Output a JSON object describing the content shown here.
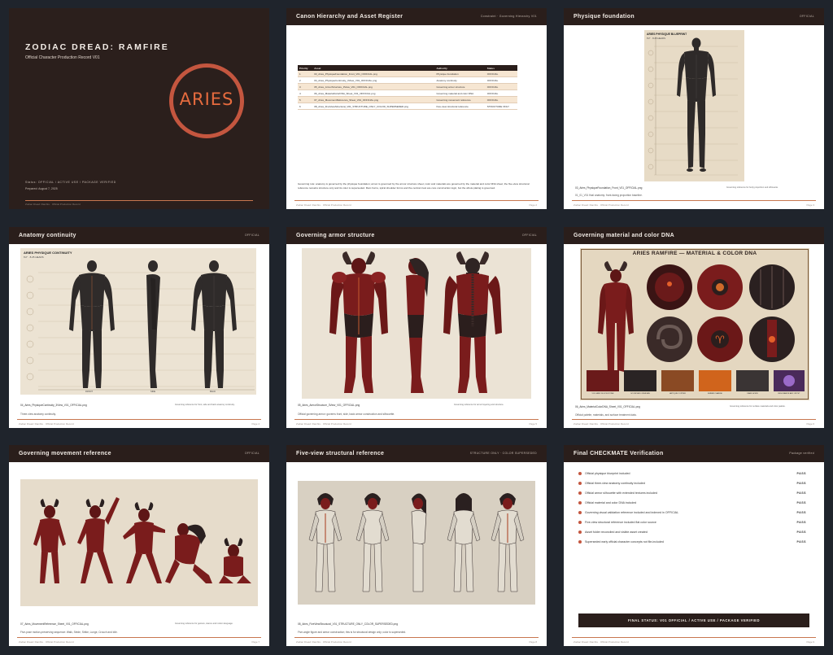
{
  "cover": {
    "title": "ZODIAC DREAD: RAMFIRE",
    "subtitle": "Official Character Production Record V01",
    "sign": "ARIES",
    "status": "Status: OFFICIAL / ACTIVE USE / PACKAGE VERIFIED",
    "prepared": "Prepared: August 7, 2025",
    "footer": "Zodiac Dread: Ramfire · Official Production Record"
  },
  "pages": [
    {
      "title": "Canon Hierarchy and Asset Register",
      "right": "Constraint · Governing Hierarchy V01",
      "footer_left": "Zodiac Dread: Ramfire · Official Production Record",
      "footer_right": "Page 2"
    },
    {
      "title": "Physique foundation",
      "right": "OFFICIAL",
      "caption1": "03_Aries_PhysiqueFoundation_Front_V01_OFFICIAL.png",
      "caption2": "Governing reference for body proportion and silhouette.",
      "caption3": "01_01_V01 final anatomy: front-facing proportion baseline.",
      "footer_left": "Zodiac Dread: Ramfire · Official Production Record",
      "footer_right": "Page 3"
    },
    {
      "title": "Anatomy continuity",
      "right": "OFFICIAL",
      "caption1": "04_Aries_PhysiqueContinuity_3View_V01_OFFICIAL.png",
      "caption2": "Governing reference for front, side and back anatomy continuity.",
      "caption3": "Three-view anatomy continuity.",
      "footer_left": "Zodiac Dread: Ramfire · Official Production Record",
      "footer_right": "Page 4"
    },
    {
      "title": "Governing armor structure",
      "right": "OFFICIAL",
      "caption1": "05_Aries_ArmorStructure_3View_V01_OFFICIAL.png",
      "caption2": "Governing reference for armor layering and structure.",
      "caption3": "Official governing armor: governs front, side, back armor construction and silhouette.",
      "footer_left": "Zodiac Dread: Ramfire · Official Production Record",
      "footer_right": "Page 5"
    },
    {
      "title": "Governing material and color DNA",
      "right": "",
      "caption1": "06_Aries_MaterialColorDNA_Sheet_V01_OFFICIAL.png",
      "caption2": "Governing reference for surface materials and color palette.",
      "caption3": "Official palette, materials, and surface treatment data.",
      "footer_left": "Zodiac Dread: Ramfire · Official Production Record",
      "footer_right": "Page 6"
    },
    {
      "title": "Governing movement reference",
      "right": "OFFICIAL",
      "caption1": "07_Aries_MovementReference_Sheet_V01_OFFICIAL.png",
      "caption2": "Governing reference for gesture, stance and motion language.",
      "caption3": "Five-pose motion-preserving sequence: Walk, Stride, Strike, Lunge, Crouch and Idle.",
      "footer_left": "Zodiac Dread: Ramfire · Official Production Record",
      "footer_right": "Page 7"
    },
    {
      "title": "Five-view structural reference",
      "right": "STRUCTURE ONLY · COLOR SUPERSEDED",
      "caption1": "08_Aries_FiveViewStructural_V01_STRUCTURE_ONLY_COLOR_SUPERSEDED.png",
      "caption2": "Structure-only reference; color superseded by material DNA sheet.",
      "caption3": "Five-angle figure and armor construction; this is for structural design only; color is superseded.",
      "footer_left": "Zodiac Dread: Ramfire · Official Production Record",
      "footer_right": "Page 8"
    },
    {
      "title": "Final CHECKMATE Verification",
      "right": "Package verified",
      "footer_left": "Zodiac Dread: Ramfire · Official Production Record",
      "footer_right": "Page 9"
    }
  ],
  "register": {
    "headers": [
      "Priority",
      "Asset",
      "Authority",
      "Status"
    ],
    "rows": [
      [
        "1",
        "03_Aries_PhysiqueFoundation_Front_V01_OFFICIAL.png",
        "Physique foundation",
        "OFFICIAL"
      ],
      [
        "2",
        "04_Aries_PhysiqueContinuity_3View_V01_OFFICIAL.png",
        "Anatomy continuity",
        "OFFICIAL"
      ],
      [
        "3",
        "05_Aries_ArmorStructure_3View_V01_OFFICIAL.png",
        "Governing armor structure",
        "OFFICIAL"
      ],
      [
        "4",
        "06_Aries_MaterialColorDNA_Sheet_V01_OFFICIAL.png",
        "Governing material and color DNA",
        "OFFICIAL"
      ],
      [
        "5",
        "07_Aries_MovementReference_Sheet_V01_OFFICIAL.png",
        "Governing movement reference",
        "OFFICIAL"
      ],
      [
        "6",
        "08_Aries_FiveViewStructural_V01_STRUCTURE_ONLY_COLOR_SUPERSEDED.png",
        "Five-view structural reference",
        "STRUCTURE ONLY"
      ]
    ],
    "note": "Governing rule: anatomy is governed by the physique foundation; armor is governed by the armor structure sheet; color and materials are governed by the material and color DNA sheet; the five-view structural reference remains structure only and its color is superseded. Ram horns, spiral shoulder forms and the central crest are core construction logic, but the whole plating is governed."
  },
  "sheets": {
    "physique": "ARIES PHYSIQUE BLUEPRINT",
    "physique_sub": "6'2\" · 8.25 HEADS",
    "continuity": "ARIES PHYSIQUE CONTINUITY",
    "continuity_sub": "6'2\" · 8.25 HEADS",
    "views": [
      "FRONT",
      "SIDE",
      "BACK"
    ],
    "dna_title": "ARIES RAMFIRE — MATERIAL & COLOR DNA",
    "swatches": [
      "VOLCANIC BLOODSTONE",
      "SCORCHED OBSIDIAN",
      "ANTIQUE COPPER",
      "EMBER CHARGE",
      "DARK HORN",
      "RESONANCE ARC CRYST"
    ]
  },
  "checklist": [
    {
      "text": "Official physique blueprint included",
      "status": "PASS"
    },
    {
      "text": "Official three-view anatomy continuity included",
      "status": "PASS"
    },
    {
      "text": "Official armor silhouette with extended textures included",
      "status": "PASS"
    },
    {
      "text": "Official material and color DNA included",
      "status": "PASS"
    },
    {
      "text": "Governing visual validation reference included and indexed in OFFICIAL",
      "status": "PASS"
    },
    {
      "text": "Five-view structural reference included flat color source",
      "status": "PASS"
    },
    {
      "text": "Asset folder reconciled and visible asset created",
      "status": "PASS"
    },
    {
      "text": "Superseded early official character concepts not file-included",
      "status": "PASS"
    }
  ],
  "final_status": "FINAL STATUS: V01 OFFICIAL / ACTIVE USE / PACKAGE VERIFIED",
  "colors": {
    "ink": "#2a1e1b",
    "ember": "#c4563f",
    "parchment": "#e9e2d6",
    "armor_red": "#7a1c1c",
    "armor_dark": "#24191a",
    "bone": "#d9d3c8"
  }
}
